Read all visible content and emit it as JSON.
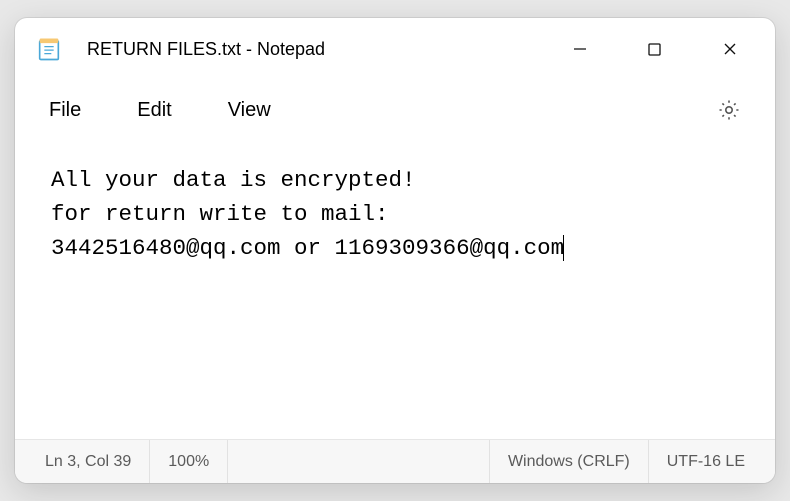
{
  "titlebar": {
    "title": "RETURN FILES.txt - Notepad"
  },
  "menu": {
    "file": "File",
    "edit": "Edit",
    "view": "View"
  },
  "content": {
    "text": "All your data is encrypted!\nfor return write to mail:\n3442516480@qq.com or 1169309366@qq.com"
  },
  "statusbar": {
    "position": "Ln 3, Col 39",
    "zoom": "100%",
    "lineending": "Windows (CRLF)",
    "encoding": "UTF-16 LE"
  }
}
